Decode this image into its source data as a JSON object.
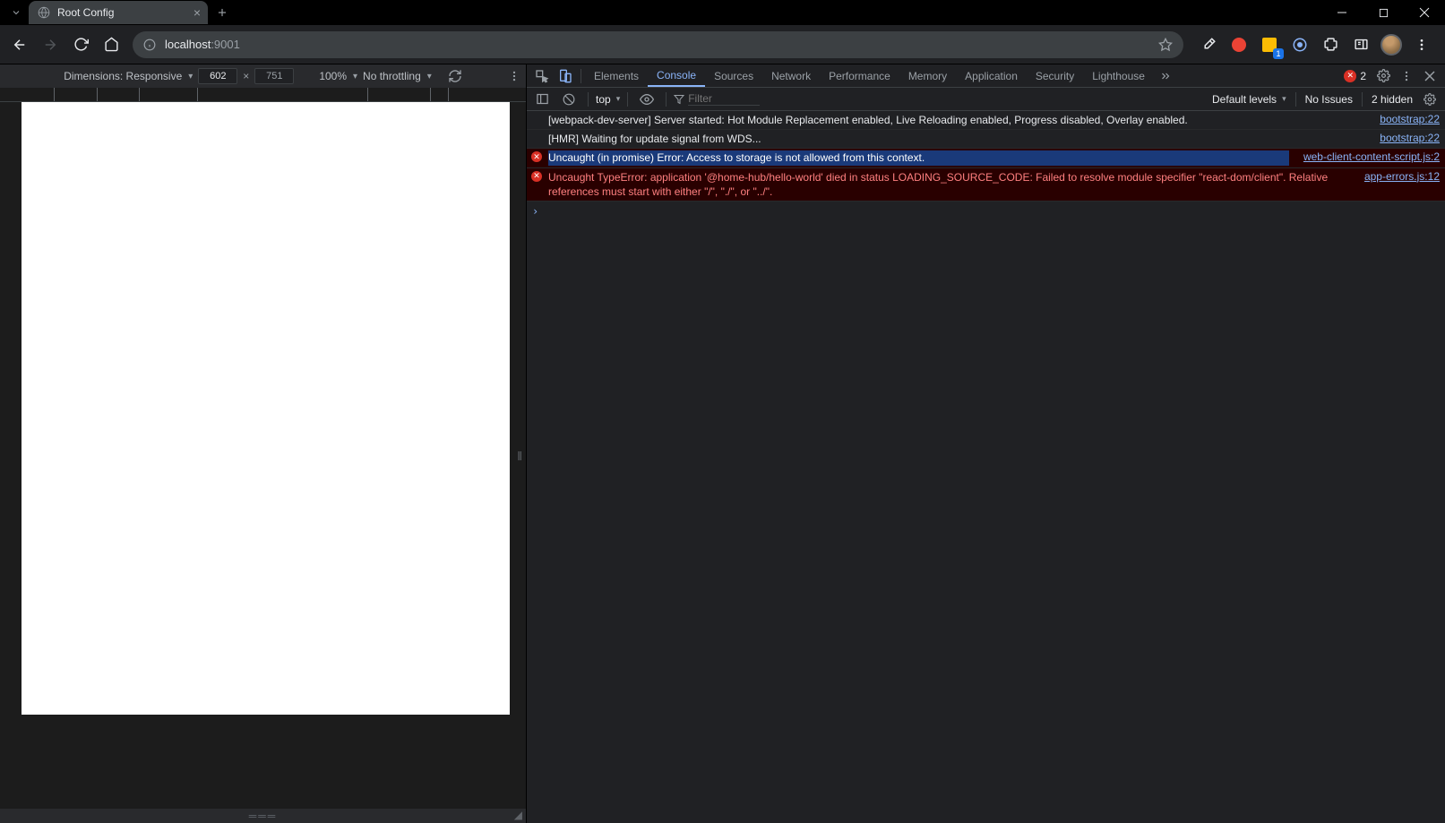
{
  "browser": {
    "tab_title": "Root Config",
    "url_host": "localhost",
    "url_port": ":9001"
  },
  "device_toolbar": {
    "dim_label": "Dimensions: Responsive",
    "width": "602",
    "height": "751",
    "zoom": "100%",
    "throttling": "No throttling"
  },
  "devtools": {
    "tabs": [
      "Elements",
      "Console",
      "Sources",
      "Network",
      "Performance",
      "Memory",
      "Application",
      "Security",
      "Lighthouse"
    ],
    "active_tab": "Console",
    "error_count": "2",
    "subbar": {
      "context": "top",
      "filter_placeholder": "Filter",
      "levels": "Default levels",
      "issues": "No Issues",
      "hidden": "2 hidden"
    },
    "messages": [
      {
        "type": "log",
        "text": "[webpack-dev-server] Server started: Hot Module Replacement enabled, Live Reloading enabled, Progress disabled, Overlay enabled.",
        "source": "bootstrap:22"
      },
      {
        "type": "log",
        "text": "[HMR] Waiting for update signal from WDS...",
        "source": "bootstrap:22"
      },
      {
        "type": "error",
        "selected": true,
        "text": "Uncaught (in promise) Error: Access to storage is not allowed from this context.",
        "source": "web-client-content-script.js:2"
      },
      {
        "type": "error",
        "text": "Uncaught TypeError: application '@home-hub/hello-world' died in status LOADING_SOURCE_CODE: Failed to resolve module specifier \"react-dom/client\". Relative references must start with either \"/\", \"./\", or \"../\".",
        "source": "app-errors.js:12"
      }
    ]
  },
  "ext_badge": "1"
}
